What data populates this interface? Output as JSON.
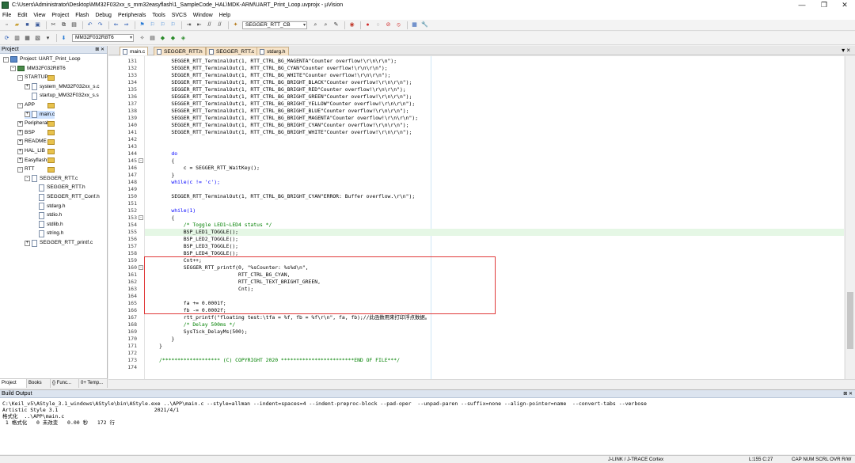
{
  "window": {
    "title": "C:\\Users\\Administrator\\Desktop\\MM32F032xx_s_mm32easyflash\\1_SampleCode_HAL\\MDK-ARM\\UART_Print_Loop.uvprojx - µVision",
    "minimize": "—",
    "restore": "❐",
    "close": "✕"
  },
  "menu": [
    "File",
    "Edit",
    "View",
    "Project",
    "Flash",
    "Debug",
    "Peripherals",
    "Tools",
    "SVCS",
    "Window",
    "Help"
  ],
  "toolbar1": {
    "combo_label": "SEGGER_RTT_CB"
  },
  "toolbar2": {
    "target_combo": "MM32F032R8T6"
  },
  "project_panel": {
    "title": "Project",
    "pin": "⊠ ✕",
    "tree": [
      {
        "label": "Project: UART_Print_Loop",
        "depth": 0,
        "exp": "-",
        "icon": "proj"
      },
      {
        "label": "MM32F032R8T6",
        "depth": 1,
        "exp": "-",
        "icon": "chip"
      },
      {
        "label": "STARTUP",
        "depth": 2,
        "exp": "-",
        "icon": "fold"
      },
      {
        "label": "system_MM32F032xx_s.c",
        "depth": 3,
        "exp": "+",
        "icon": "file"
      },
      {
        "label": "startup_MM32F032xx_s.s",
        "depth": 3,
        "exp": "",
        "icon": "file"
      },
      {
        "label": "APP",
        "depth": 2,
        "exp": "-",
        "icon": "fold"
      },
      {
        "label": "main.c",
        "depth": 3,
        "exp": "+",
        "icon": "file",
        "sel": true
      },
      {
        "label": "Peripheral",
        "depth": 2,
        "exp": "+",
        "icon": "fold"
      },
      {
        "label": "BSP",
        "depth": 2,
        "exp": "+",
        "icon": "fold"
      },
      {
        "label": "README",
        "depth": 2,
        "exp": "+",
        "icon": "fold"
      },
      {
        "label": "HAL_LIB",
        "depth": 2,
        "exp": "+",
        "icon": "fold"
      },
      {
        "label": "Easyflash",
        "depth": 2,
        "exp": "+",
        "icon": "fold"
      },
      {
        "label": "RTT",
        "depth": 2,
        "exp": "-",
        "icon": "fold"
      },
      {
        "label": "SEGGER_RTT.c",
        "depth": 3,
        "exp": "-",
        "icon": "file"
      },
      {
        "label": "SEGGER_RTT.h",
        "depth": 4,
        "exp": "",
        "icon": "file"
      },
      {
        "label": "SEGGER_RTT_Conf.h",
        "depth": 4,
        "exp": "",
        "icon": "file"
      },
      {
        "label": "stdarg.h",
        "depth": 4,
        "exp": "",
        "icon": "file"
      },
      {
        "label": "stdio.h",
        "depth": 4,
        "exp": "",
        "icon": "file"
      },
      {
        "label": "stdlib.h",
        "depth": 4,
        "exp": "",
        "icon": "file"
      },
      {
        "label": "string.h",
        "depth": 4,
        "exp": "",
        "icon": "file"
      },
      {
        "label": "SEGGER_RTT_printf.c",
        "depth": 3,
        "exp": "+",
        "icon": "file"
      }
    ],
    "tabs": [
      "Project",
      "Books",
      "{} Func...",
      "0+ Temp..."
    ]
  },
  "editor_tabs": [
    {
      "label": "main.c",
      "active": true
    },
    {
      "label": "SEGGER_RTT.h",
      "active": false
    },
    {
      "label": "SEGGER_RTT.c",
      "active": false
    },
    {
      "label": "stdarg.h",
      "active": false
    }
  ],
  "editor_menu": "▾ ×",
  "code_lines": [
    {
      "n": "131",
      "fold": "",
      "t": "    SEGGER_RTT_TerminalOut(1, RTT_CTRL_BG_MAGENTA\"Counter overflow!\\r\\n\\r\\n\");"
    },
    {
      "n": "132",
      "fold": "",
      "t": "    SEGGER_RTT_TerminalOut(1, RTT_CTRL_BG_CYAN\"Counter overflow!\\r\\n\\r\\n\");"
    },
    {
      "n": "133",
      "fold": "",
      "t": "    SEGGER_RTT_TerminalOut(1, RTT_CTRL_BG_WHITE\"Counter overflow!\\r\\n\\r\\n\");"
    },
    {
      "n": "134",
      "fold": "",
      "t": "    SEGGER_RTT_TerminalOut(1, RTT_CTRL_BG_BRIGHT_BLACK\"Counter overflow!\\r\\n\\r\\n\");"
    },
    {
      "n": "135",
      "fold": "",
      "t": "    SEGGER_RTT_TerminalOut(1, RTT_CTRL_BG_BRIGHT_RED\"Counter overflow!\\r\\n\\r\\n\");"
    },
    {
      "n": "136",
      "fold": "",
      "t": "    SEGGER_RTT_TerminalOut(1, RTT_CTRL_BG_BRIGHT_GREEN\"Counter overflow!\\r\\n\\r\\n\");"
    },
    {
      "n": "137",
      "fold": "",
      "t": "    SEGGER_RTT_TerminalOut(1, RTT_CTRL_BG_BRIGHT_YELLOW\"Counter overflow!\\r\\n\\r\\n\");"
    },
    {
      "n": "138",
      "fold": "",
      "t": "    SEGGER_RTT_TerminalOut(1, RTT_CTRL_BG_BRIGHT_BLUE\"Counter overflow!\\r\\n\\r\\n\");"
    },
    {
      "n": "139",
      "fold": "",
      "t": "    SEGGER_RTT_TerminalOut(1, RTT_CTRL_BG_BRIGHT_MAGENTA\"Counter overflow!\\r\\n\\r\\n\");"
    },
    {
      "n": "140",
      "fold": "",
      "t": "    SEGGER_RTT_TerminalOut(1, RTT_CTRL_BG_BRIGHT_CYAN\"Counter overflow!\\r\\n\\r\\n\");"
    },
    {
      "n": "141",
      "fold": "",
      "t": "    SEGGER_RTT_TerminalOut(1, RTT_CTRL_BG_BRIGHT_WHITE\"Counter overflow!\\r\\n\\r\\n\");"
    },
    {
      "n": "142",
      "fold": "",
      "t": ""
    },
    {
      "n": "143",
      "fold": "",
      "t": ""
    },
    {
      "n": "144",
      "fold": "",
      "t": "    do"
    },
    {
      "n": "145",
      "fold": "-",
      "t": "    {"
    },
    {
      "n": "146",
      "fold": "",
      "t": "        c = SEGGER_RTT_WaitKey();"
    },
    {
      "n": "147",
      "fold": "",
      "t": "    }"
    },
    {
      "n": "148",
      "fold": "",
      "t": "    while(c != 'c');"
    },
    {
      "n": "149",
      "fold": "",
      "t": ""
    },
    {
      "n": "150",
      "fold": "",
      "t": "    SEGGER_RTT_TerminalOut(1, RTT_CTRL_BG_BRIGHT_CYAN\"ERROR: Buffer overflow.\\r\\n\");"
    },
    {
      "n": "151",
      "fold": "",
      "t": ""
    },
    {
      "n": "152",
      "fold": "",
      "t": "    while(1)"
    },
    {
      "n": "153",
      "fold": "-",
      "t": "    {"
    },
    {
      "n": "154",
      "fold": "",
      "t": "        /* Toggle LED1~LED4 status */"
    },
    {
      "n": "155",
      "fold": "",
      "t": "        BSP_LED1_TOGGLE();"
    },
    {
      "n": "156",
      "fold": "",
      "t": "        BSP_LED2_TOGGLE();"
    },
    {
      "n": "157",
      "fold": "",
      "t": "        BSP_LED3_TOGGLE();"
    },
    {
      "n": "158",
      "fold": "",
      "t": "        BSP_LED4_TOGGLE();"
    },
    {
      "n": "159",
      "fold": "",
      "t": "        Cnt++;"
    },
    {
      "n": "160",
      "fold": "-",
      "t": "        SEGGER_RTT_printf(0, \"%sCounter: %s%d\\n\","
    },
    {
      "n": "161",
      "fold": "",
      "t": "                          RTT_CTRL_BG_CYAN,"
    },
    {
      "n": "162",
      "fold": "",
      "t": "                          RTT_CTRL_TEXT_BRIGHT_GREEN,"
    },
    {
      "n": "163",
      "fold": "",
      "t": "                          Cnt);"
    },
    {
      "n": "164",
      "fold": "",
      "t": ""
    },
    {
      "n": "165",
      "fold": "",
      "t": "        fa += 0.0001f;"
    },
    {
      "n": "166",
      "fold": "",
      "t": "        fb -= 0.0002f;"
    },
    {
      "n": "167",
      "fold": "",
      "t": "        rtt_printf(\"floating test:\\tfa = %f, fb = %f\\r\\n\", fa, fb);//此函数用来打印浮点数据。"
    },
    {
      "n": "168",
      "fold": "",
      "t": "        /* Delay 500ms */"
    },
    {
      "n": "169",
      "fold": "",
      "t": "        SysTick_DelayMs(500);"
    },
    {
      "n": "170",
      "fold": "",
      "t": "    }"
    },
    {
      "n": "171",
      "fold": "",
      "t": "}"
    },
    {
      "n": "172",
      "fold": "",
      "t": ""
    },
    {
      "n": "173",
      "fold": "",
      "t": "/******************* (C) COPYRIGHT 2020 ************************END OF FILE***/"
    },
    {
      "n": "174",
      "fold": "",
      "t": ""
    }
  ],
  "build_output": {
    "title": "Build Output",
    "pin": "⊠ ✕",
    "lines": [
      "C:\\Keil_v5\\AStyle_3.1_windows\\AStyle\\bin\\AStyle.exe ..\\APP\\main.c --style=allman --indent=spaces=4 --indent-preproc-block --pad-oper  --unpad-paren --suffix=none --align-pointer=name  --convert-tabs --verbose",
      "Artistic Style 3.1                               2021/4/1",
      "格式化  ..\\APP\\main.c",
      " 1 格式化   0 未改变   0.00 秒   172 行"
    ]
  },
  "status": {
    "debugger": "J-LINK / J-TRACE Cortex",
    "position": "L:155 C:27",
    "flags": "CAP  NUM  SCRL  OVR  R/W"
  },
  "colors": {
    "comment": "#008000",
    "keyword": "#0000ff",
    "string": "#a31515",
    "highlight_box": "#e03a3a"
  }
}
